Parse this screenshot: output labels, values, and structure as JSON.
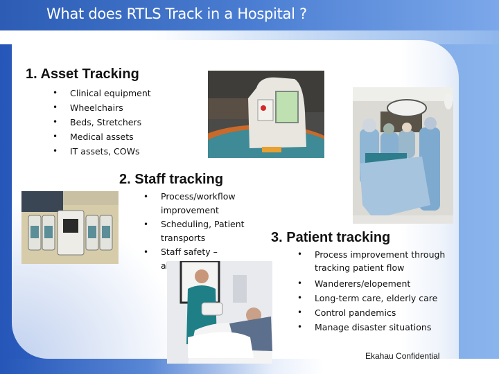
{
  "slide": {
    "title": "What does RTLS Track in a Hospital ?",
    "sections": [
      {
        "heading": "1. Asset Tracking",
        "items": [
          "Clinical equipment",
          "Wheelchairs",
          "Beds, Stretchers",
          "Medical assets",
          "IT assets, COWs"
        ]
      },
      {
        "heading": "2. Staff tracking",
        "items": [
          "Process/workflow improvement",
          "Scheduling, Patient transports",
          "Staff safety – alarms"
        ]
      },
      {
        "heading": "3. Patient tracking",
        "items": [
          "Process improvement through tracking patient flow",
          "Wanderers/elopement",
          "Long-term care, elderly care",
          "Control pandemics",
          "Manage disaster situations"
        ]
      }
    ],
    "bullet_glyph": "•",
    "images": [
      {
        "name": "infusion-pump-photo",
        "description": "Infusion pump with RTLS tag"
      },
      {
        "name": "operating-room-photo",
        "description": "Surgeons in operating room"
      },
      {
        "name": "pump-modules-photo",
        "description": "Infusion pump modules"
      },
      {
        "name": "nurse-patient-photo",
        "description": "Nurse with patient in bed"
      }
    ],
    "footer": "Ekahau Confidential"
  }
}
